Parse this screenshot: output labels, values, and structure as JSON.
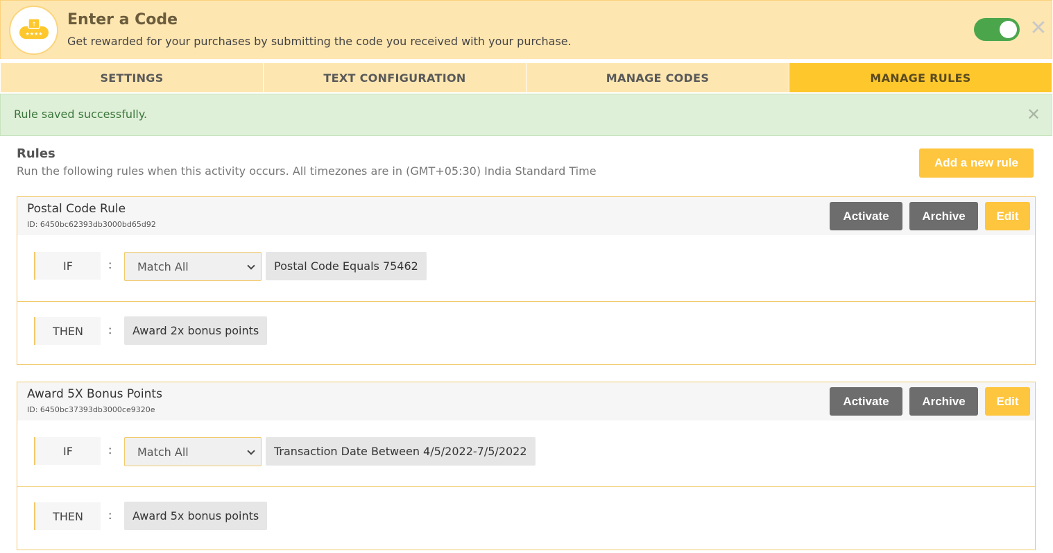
{
  "header": {
    "title": "Enter a Code",
    "subtitle": "Get rewarded for your purchases by submitting the code you received with your purchase.",
    "logo_icon": "coupon-ticket-icon",
    "toggle_on": true,
    "close_icon": "close-icon"
  },
  "tabs": [
    {
      "label": "SETTINGS",
      "active": false
    },
    {
      "label": "TEXT CONFIGURATION",
      "active": false
    },
    {
      "label": "MANAGE CODES",
      "active": false
    },
    {
      "label": "MANAGE RULES",
      "active": true
    }
  ],
  "alert": {
    "text": "Rule saved successfully.",
    "close_icon": "close-icon"
  },
  "rules_section": {
    "title": "Rules",
    "subtitle": "Run the following rules when this activity occurs. All timezones are in (GMT+05:30) India Standard Time",
    "add_button": "Add a new rule"
  },
  "rules": [
    {
      "name": "Postal Code Rule",
      "id_text": "ID: 6450bc62393db3000bd65d92",
      "activate_label": "Activate",
      "archive_label": "Archive",
      "edit_label": "Edit",
      "if_label": "IF",
      "match_value": "Match All",
      "condition": "Postal Code Equals 75462",
      "then_label": "THEN",
      "action": "Award 2x bonus points"
    },
    {
      "name": "Award 5X Bonus Points",
      "id_text": "ID: 6450bc37393db3000ce9320e",
      "activate_label": "Activate",
      "archive_label": "Archive",
      "edit_label": "Edit",
      "if_label": "IF",
      "match_value": "Match All",
      "condition": "Transaction Date Between 4/5/2022-7/5/2022",
      "then_label": "THEN",
      "action": "Award 5x bonus points"
    }
  ],
  "colors": {
    "header_bg": "#fee6b1",
    "active_tab": "#fec72b",
    "accent_button": "#fec53e",
    "dark_button": "#6d6d6d",
    "success_bg": "#dff0d8",
    "success_text": "#3c763d",
    "toggle_on": "#4ba64b"
  }
}
